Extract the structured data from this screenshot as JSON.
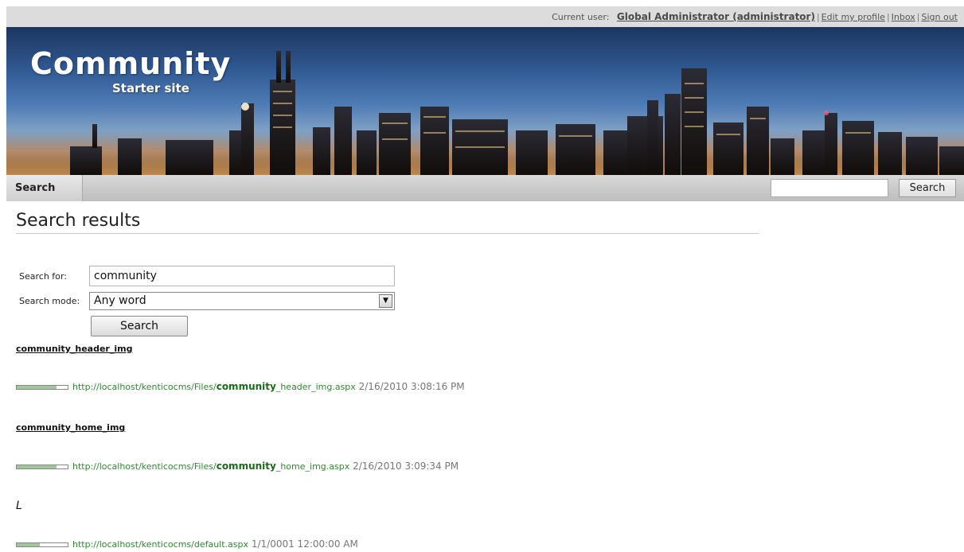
{
  "topbar": {
    "current_user_label": "Current user:",
    "user_name": "Global Administrator (administrator)",
    "links": [
      "Edit my profile",
      "Inbox",
      "Sign out"
    ]
  },
  "header": {
    "logo_title": "Community",
    "logo_subtitle": "Starter site"
  },
  "nav": {
    "tab_label": "Search",
    "search_placeholder": "",
    "search_button": "Search"
  },
  "page": {
    "title": "Search results"
  },
  "form": {
    "search_for_label": "Search for:",
    "search_for_value": "community",
    "search_mode_label": "Search mode:",
    "search_mode_value": "Any word",
    "search_button": "Search"
  },
  "results": [
    {
      "title": "community_header_img",
      "url_prefix": "http://localhost/kenticocms/Files/",
      "url_match": "community",
      "url_suffix": "_header_img.aspx",
      "date": "2/16/2010 3:08:16 PM",
      "relevance": 0.78
    },
    {
      "title": "community_home_img",
      "url_prefix": "http://localhost/kenticocms/Files/",
      "url_match": "community",
      "url_suffix": "_home_img.aspx",
      "date": "2/16/2010 3:09:34 PM",
      "relevance": 0.78
    },
    {
      "title": "L",
      "url_prefix": "http://localhost/kenticocms/default.aspx",
      "url_match": "",
      "url_suffix": "",
      "date": "1/1/0001 12:00:00 AM",
      "relevance": 0.45
    }
  ],
  "colors": {
    "url_green": "#2e8b2e",
    "relevance_fill": "#9fc79a"
  }
}
